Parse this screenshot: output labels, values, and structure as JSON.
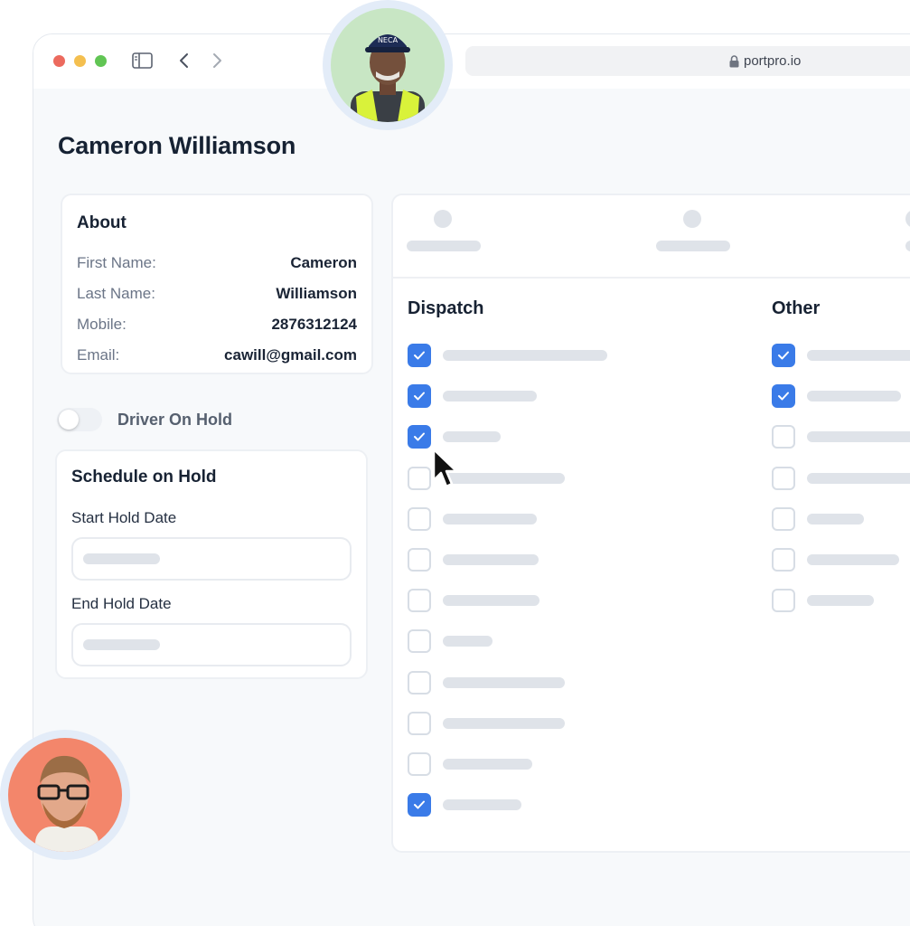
{
  "browser": {
    "url": "portpro.io",
    "icons": {
      "sidebar": "sidebar-toggle-icon",
      "back": "chevron-left-icon",
      "forward": "chevron-right-icon",
      "lock": "lock-icon"
    },
    "traffic_lights": [
      "#ec6a5e",
      "#f4bf4f",
      "#61c554"
    ]
  },
  "page": {
    "title": "Cameron Williamson"
  },
  "about": {
    "title": "About",
    "rows": [
      {
        "label": "First Name:",
        "value": "Cameron"
      },
      {
        "label": "Last Name:",
        "value": "Williamson"
      },
      {
        "label": "Mobile:",
        "value": "2876312124"
      },
      {
        "label": "Email:",
        "value": "cawill@gmail.com"
      }
    ]
  },
  "hold_toggle": {
    "label": "Driver On Hold",
    "on": false
  },
  "schedule": {
    "title": "Schedule on Hold",
    "start_label": "Start Hold Date",
    "end_label": "End Hold Date"
  },
  "permissions": {
    "dispatch_title": "Dispatch",
    "other_title": "Other",
    "dispatch_checked": [
      true,
      true,
      true,
      false,
      false,
      false,
      false,
      false,
      false,
      false,
      false,
      true
    ],
    "other_checked": [
      true,
      true,
      false,
      false,
      false,
      false,
      false
    ]
  },
  "colors": {
    "accent": "#3a7be8",
    "avatar_top_bg": "#c8e6c4",
    "avatar_bottom_bg": "#f3866b"
  }
}
